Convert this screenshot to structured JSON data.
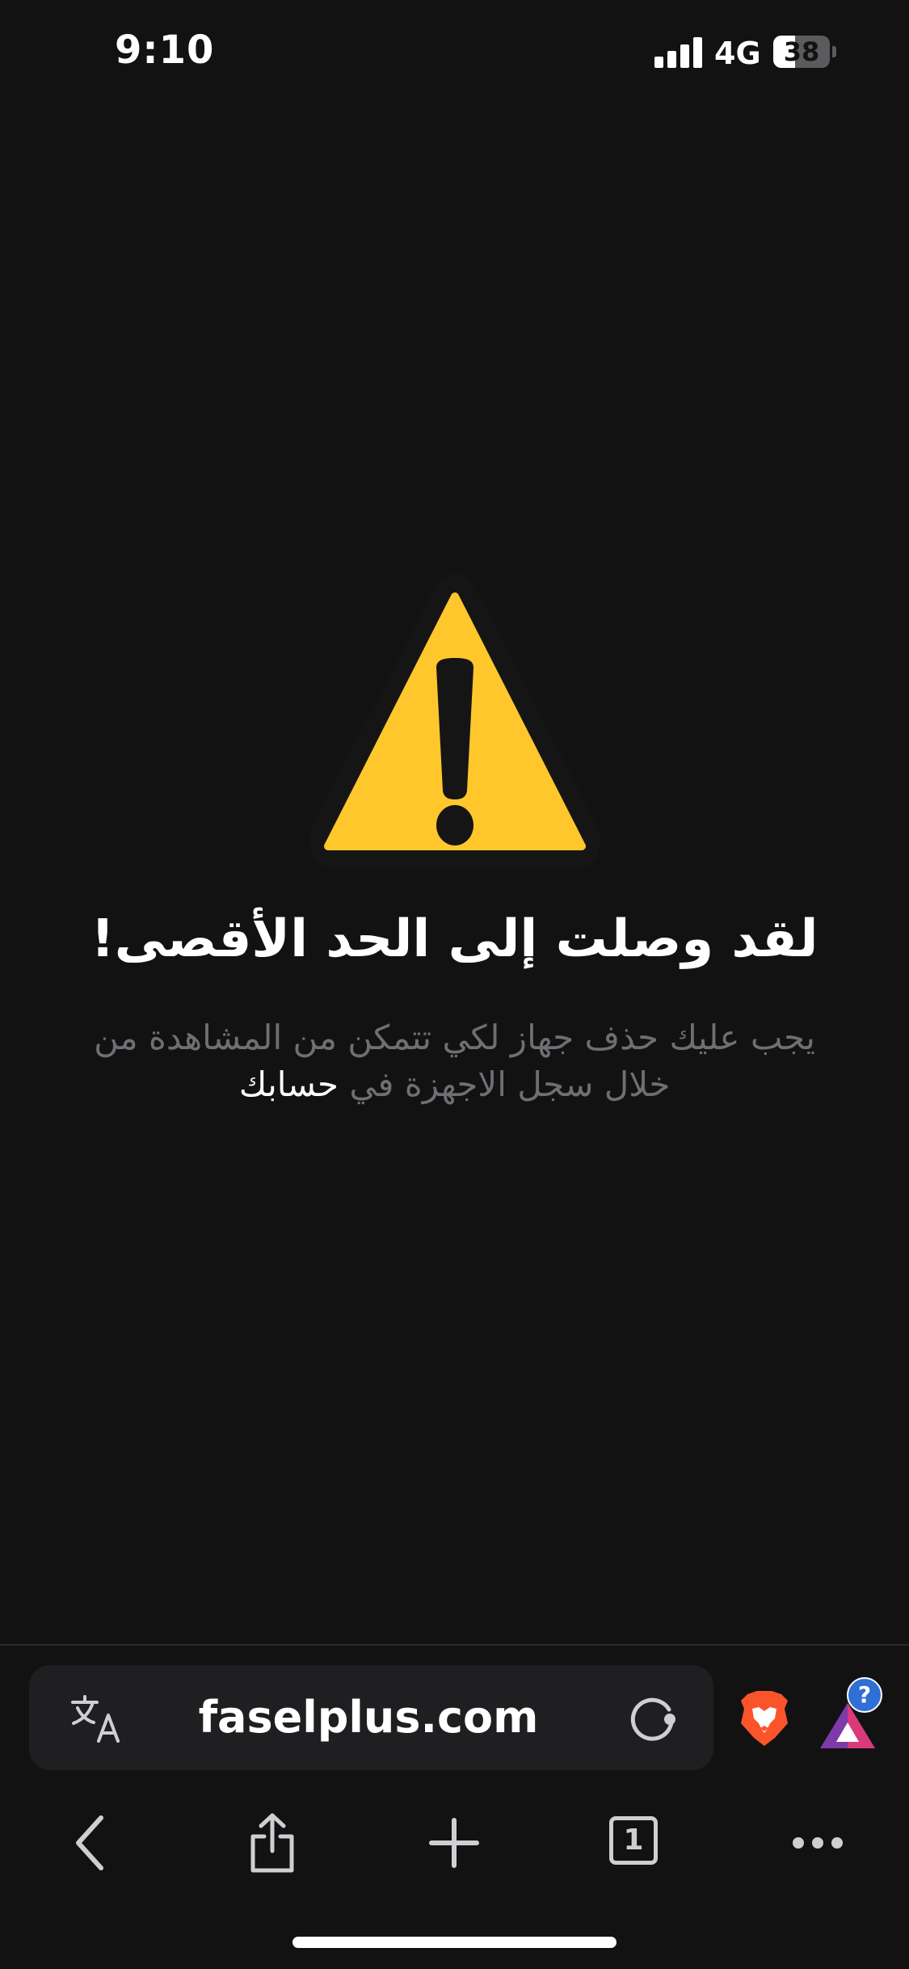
{
  "status_bar": {
    "time": "9:10",
    "network": "4G",
    "battery_level": "38",
    "battery_percent": 38
  },
  "warning": {
    "icon": "warning-triangle-icon",
    "icon_color": "#FFC72C",
    "title": "لقد وصلت إلى الحد الأقصى!",
    "message": "يجب عليك حذف جهاز لكي تتمكن من المشاهدة من خلال سجل الاجهزة في",
    "account_link": "حسابك"
  },
  "browser": {
    "url": "faselplus.com",
    "translate_icon": "translate-icon",
    "reload_icon": "reload-icon",
    "brave_shields_icon": "brave-lion-icon",
    "rewards_icon": "brave-rewards-icon",
    "rewards_badge": "?",
    "toolbar": {
      "back_icon": "back-chevron-icon",
      "share_icon": "share-icon",
      "new_tab_icon": "plus-icon",
      "tab_count": "1",
      "menu_icon": "more-dots-icon"
    }
  },
  "colors": {
    "background": "#121213",
    "url_bar": "#1F1F21",
    "brave_orange": "#FB542B",
    "badge_blue": "#2F6FD6"
  }
}
